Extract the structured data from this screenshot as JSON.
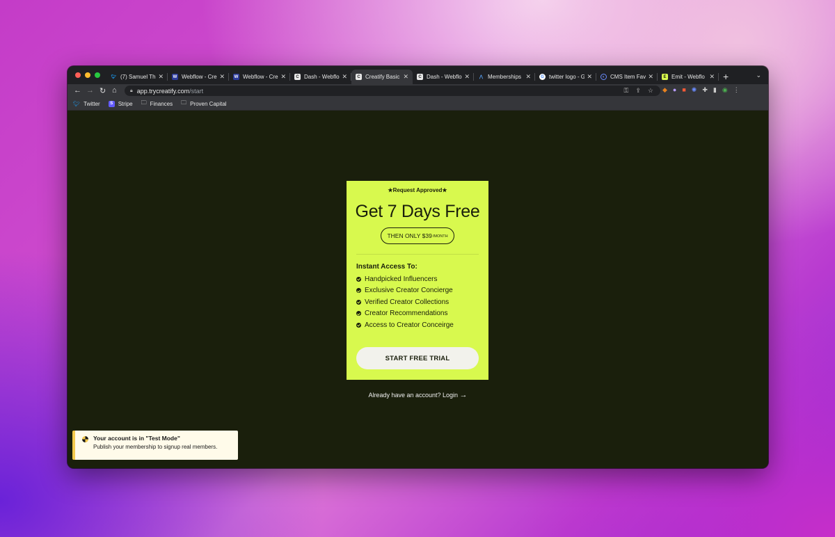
{
  "browser": {
    "tabs": [
      {
        "title": "(7) Samuel Th",
        "favicon": "twitter-icon",
        "active": false
      },
      {
        "title": "Webflow - Cre",
        "favicon": "webflow-icon",
        "active": false
      },
      {
        "title": "Webflow - Cre",
        "favicon": "webflow-icon",
        "active": false
      },
      {
        "title": "Dash - Webflo",
        "favicon": "creatify-icon",
        "active": false
      },
      {
        "title": "Creatify Basic",
        "favicon": "creatify-icon",
        "active": true
      },
      {
        "title": "Dash - Webflo",
        "favicon": "creatify-icon",
        "active": false
      },
      {
        "title": "Memberships",
        "favicon": "memberstack-icon",
        "active": false
      },
      {
        "title": "twitter logo - G",
        "favicon": "google-icon",
        "active": false
      },
      {
        "title": "CMS Item Fav",
        "favicon": "cms-icon",
        "active": false
      },
      {
        "title": "Emit - Webflo",
        "favicon": "emit-icon",
        "active": false
      }
    ],
    "url_host": "app.trycreatify.com",
    "url_path": "/start",
    "bookmarks": [
      {
        "label": "Twitter",
        "icon": "twitter-icon"
      },
      {
        "label": "Stripe",
        "icon": "stripe-icon"
      },
      {
        "label": "Finances",
        "icon": "folder-icon"
      },
      {
        "label": "Proven Capital",
        "icon": "folder-icon"
      }
    ]
  },
  "card": {
    "badge": "★Request Approved★",
    "headline": "Get 7 Days Free",
    "price_prefix": "THEN ONLY $39",
    "price_suffix": "/MONTH",
    "access_title": "Instant Access To:",
    "features": [
      "Handpicked Influencers",
      "Exclusive Creator Concierge",
      "Verified Creator Collections",
      "Creator Recommendations",
      "Access to Creator Conceirge"
    ],
    "cta_label": "START FREE TRIAL"
  },
  "login_prompt": "Already have an account? Login",
  "toast": {
    "title": "Your account is in \"Test Mode\"",
    "message": "Publish your membership to signup real members."
  },
  "colors": {
    "card_bg": "#d8f94e",
    "page_bg": "#1a1f0c",
    "toast_accent": "#f2c94c"
  }
}
